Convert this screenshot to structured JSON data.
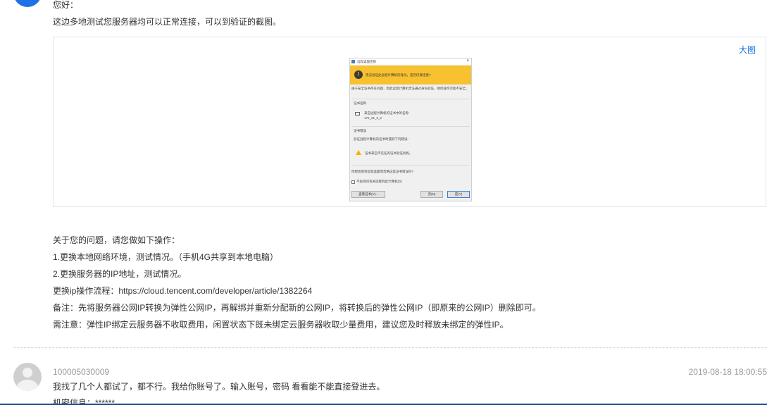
{
  "first_message": {
    "greeting": "您好：",
    "intro": "这边多地测试您服务器均可以正常连接，可以到验证的截图。",
    "image_link_label": "大图",
    "dialog": {
      "title": "远程桌面连接",
      "close": "×",
      "banner": "无法验证此远程计算机的身份。是否仍要连接?",
      "description": "由于安全证书存在问题，因此远程计算机无法通过身份验证。继续操作可能不安全。",
      "cert_name_title": "证书名称",
      "cert_line1": "来自远程计算机的证书中的名称:",
      "cert_line2": "172_21_0_2",
      "cert_error_title": "证书错误",
      "cert_error_line": "验证远程计算机的证书时遇到下列错误:",
      "cert_error_item": "证书来自不信任的证书验证机构。",
      "question": "你想连接到远程桌面而忽略这些证书错误吗?",
      "checkbox_label": "不再询问有关连接到此计算机(D)",
      "view_cert_button": "查看证书(V)...",
      "no_button": "否(N)",
      "yes_button": "是(Y)"
    },
    "lines": [
      "关于您的问题，请您做如下操作：",
      "1.更换本地网络环境，测试情况。（手机4G共享到本地电脑）",
      "2.更换服务器的IP地址，测试情况。",
      "更换ip操作流程：https://cloud.tencent.com/developer/article/1382264",
      "备注：先将服务器公网IP转换为弹性公网IP，再解绑并重新分配新的公网IP，将转换后的弹性公网IP（即原来的公网IP）删除即可。",
      "需注意：弹性IP绑定云服务器不收取费用，闲置状态下既未绑定云服务器收取少量费用，建议您及时释放未绑定的弹性IP。"
    ]
  },
  "reply": {
    "user_id": "100005030009",
    "timestamp": "2019-08-18 18:00:55",
    "line1": "我找了几个人都试了，都不行。我给你账号了。输入账号，密码  看看能不能直接登进去。",
    "line2": "机密信息：******"
  },
  "colors": {
    "link": "#1a73e8",
    "avatar_blue": "#1e6fe8",
    "banner_yellow": "#f7c12f"
  }
}
